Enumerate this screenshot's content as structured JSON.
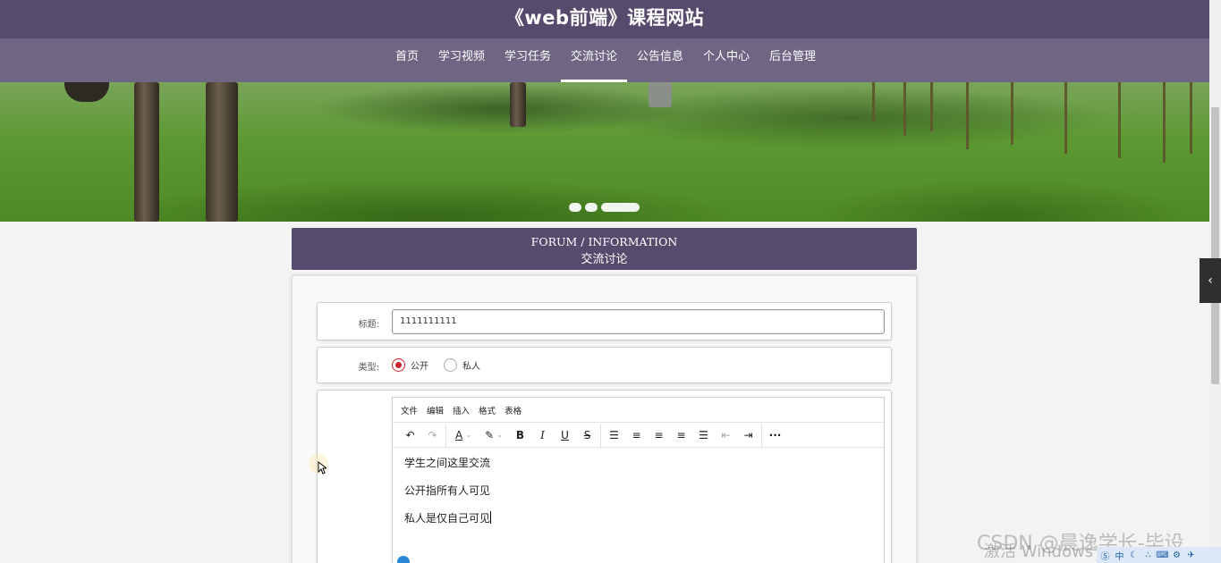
{
  "site": {
    "title": "《web前端》课程网站"
  },
  "nav": {
    "items": [
      {
        "label": "首页",
        "active": false
      },
      {
        "label": "学习视频",
        "active": false
      },
      {
        "label": "学习任务",
        "active": false
      },
      {
        "label": "交流讨论",
        "active": true
      },
      {
        "label": "公告信息",
        "active": false
      },
      {
        "label": "个人中心",
        "active": false
      },
      {
        "label": "后台管理",
        "active": false
      }
    ]
  },
  "banner": {
    "slides": 3,
    "active_slide": 3
  },
  "section": {
    "title_en": "FORUM / INFORMATION",
    "title_cn": "交流讨论"
  },
  "form": {
    "title_label": "标题:",
    "title_value": "1111111111",
    "type_label": "类型:",
    "type_options": [
      {
        "label": "公开",
        "checked": true
      },
      {
        "label": "私人",
        "checked": false
      }
    ],
    "editor": {
      "menu": [
        "文件",
        "编辑",
        "插入",
        "格式",
        "表格"
      ],
      "paragraphs": [
        "学生之间这里交流",
        "公开指所有人可见",
        "私人是仅自己可见"
      ]
    }
  },
  "overlay": {
    "watermark": "CSDN @晨逸学长-毕设",
    "activate_text": "激活 Windows",
    "tray_icons": [
      "s-icon",
      "zhong-icon",
      "moon-icon",
      "dots-icon",
      "keyboard-icon",
      "gear-icon",
      "shirt-icon"
    ]
  }
}
